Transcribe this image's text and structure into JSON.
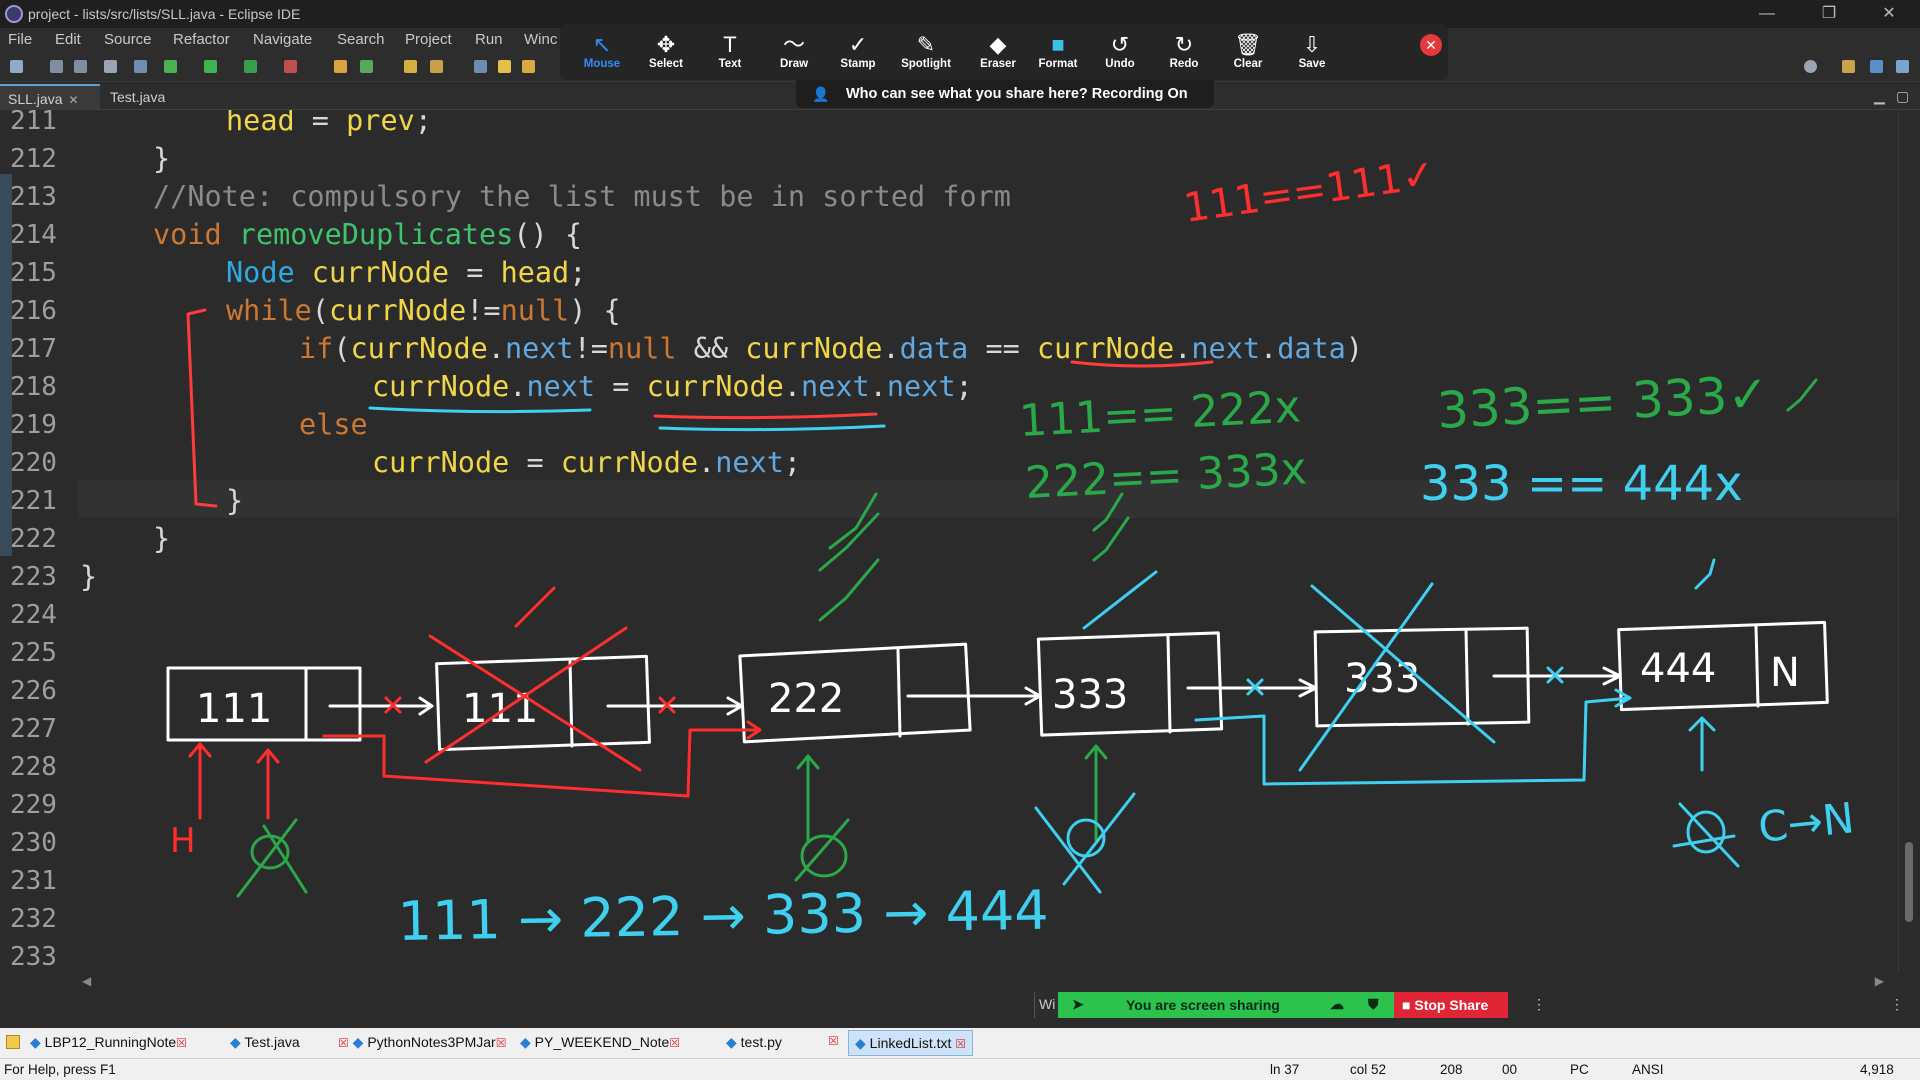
{
  "window": {
    "title": "project - lists/src/lists/SLL.java - Eclipse IDE",
    "minimize": "—",
    "restore": "❐",
    "close": "✕"
  },
  "menu": [
    "File",
    "Edit",
    "Source",
    "Refactor",
    "Navigate",
    "Search",
    "Project",
    "Run",
    "Winc"
  ],
  "editor_tabs": [
    {
      "label": "SLL.java",
      "active": true
    },
    {
      "label": "Test.java",
      "active": false
    }
  ],
  "annotation_toolbar": {
    "tools": [
      {
        "label": "Mouse",
        "glyph": "↖"
      },
      {
        "label": "Select",
        "glyph": "✥"
      },
      {
        "label": "Text",
        "glyph": "T"
      },
      {
        "label": "Draw",
        "glyph": "〜"
      },
      {
        "label": "Stamp",
        "glyph": "✓"
      },
      {
        "label": "Spotlight",
        "glyph": "✎"
      },
      {
        "label": "Eraser",
        "glyph": "◆"
      },
      {
        "label": "Format",
        "glyph": "■"
      },
      {
        "label": "Undo",
        "glyph": "↺"
      },
      {
        "label": "Redo",
        "glyph": "↻"
      },
      {
        "label": "Clear",
        "glyph": "🗑"
      },
      {
        "label": "Save",
        "glyph": "⇩"
      }
    ],
    "selected": "Mouse",
    "close_glyph": "✕",
    "recording_notice": "Who can see what you share here? Recording On",
    "colors": {
      "selected": "#2f8cff",
      "close": "#e5393b",
      "format": "#3bc0e8"
    }
  },
  "code": {
    "line_numbers": [
      "211",
      "212",
      "213",
      "214",
      "215",
      "216",
      "217",
      "218",
      "219",
      "220",
      "221",
      "222",
      "223",
      "224",
      "225",
      "226",
      "227",
      "228",
      "229",
      "230",
      "231",
      "232",
      "233"
    ],
    "lines": [
      [
        [
          "head",
          "vr"
        ],
        [
          " = ",
          ""
        ],
        [
          "prev",
          "vr"
        ],
        [
          ";",
          ""
        ]
      ],
      [
        [
          "}",
          ""
        ]
      ],
      [
        [
          "//Note: compulsory the list must be in sorted form",
          "cm"
        ]
      ],
      [
        [
          "void ",
          "kw"
        ],
        [
          "removeDuplicates",
          "fn"
        ],
        [
          "() {",
          ""
        ]
      ],
      [
        [
          "Node ",
          "ty"
        ],
        [
          "currNode",
          "vr"
        ],
        [
          " = ",
          ""
        ],
        [
          "head",
          "vr"
        ],
        [
          ";",
          ""
        ]
      ],
      [
        [
          "while",
          "kw"
        ],
        [
          "(",
          ""
        ],
        [
          "currNode",
          "vr"
        ],
        [
          "!=",
          ""
        ],
        [
          "null",
          "kw"
        ],
        [
          ") {",
          ""
        ]
      ],
      [
        [
          "if",
          "kw"
        ],
        [
          "(",
          ""
        ],
        [
          "currNode",
          "vr"
        ],
        [
          ".",
          ""
        ],
        [
          "next",
          "fd"
        ],
        [
          "!=",
          ""
        ],
        [
          "null",
          "kw"
        ],
        [
          " && ",
          ""
        ],
        [
          "currNode",
          "vr"
        ],
        [
          ".",
          ""
        ],
        [
          "data",
          "fd"
        ],
        [
          " == ",
          ""
        ],
        [
          "currNode",
          "vr"
        ],
        [
          ".",
          ""
        ],
        [
          "next",
          "fd"
        ],
        [
          ".",
          ""
        ],
        [
          "data",
          "fd"
        ],
        [
          ")",
          ""
        ]
      ],
      [
        [
          "currNode",
          "vr"
        ],
        [
          ".",
          ""
        ],
        [
          "next",
          "fd"
        ],
        [
          " = ",
          ""
        ],
        [
          "currNode",
          "vr"
        ],
        [
          ".",
          ""
        ],
        [
          "next",
          "fd"
        ],
        [
          ".",
          ""
        ],
        [
          "next",
          "fd"
        ],
        [
          ";",
          ""
        ]
      ],
      [
        [
          "else",
          "kw"
        ]
      ],
      [
        [
          "currNode",
          "vr"
        ],
        [
          " = ",
          ""
        ],
        [
          "currNode",
          "vr"
        ],
        [
          ".",
          ""
        ],
        [
          "next",
          "fd"
        ],
        [
          ";",
          ""
        ]
      ],
      [
        [
          "}",
          ""
        ]
      ],
      [
        [
          "}",
          ""
        ]
      ],
      [
        [
          "}",
          ""
        ]
      ]
    ],
    "indent": [
      2,
      1,
      1,
      1,
      2,
      2,
      3,
      4,
      3,
      4,
      2,
      1,
      0
    ]
  },
  "handwriting": {
    "compare1": "111==111✓",
    "compare2": "111== 222x",
    "compare3": "222== 333x",
    "compare4": "333== 333✓",
    "compare5": "333 == 444x",
    "node_values": [
      "111",
      "111",
      "222",
      "333",
      "333",
      "444"
    ],
    "last_next": "N",
    "labels": {
      "head": "H",
      "cleared": "C",
      "c_to_n": "C→N"
    },
    "result": "111 → 222 → 333 → 444"
  },
  "share_bar": {
    "status": "You are screen sharing",
    "stop": "Stop Share",
    "w_tab": "Wi"
  },
  "bottom_tabs": [
    {
      "label": "LBP12_RunningNote"
    },
    {
      "label": "Test.java"
    },
    {
      "label": "PythonNotes3PMJar"
    },
    {
      "label": "PY_WEEKEND_Note"
    },
    {
      "label": "test.py"
    },
    {
      "label": "LinkedList.txt"
    }
  ],
  "status_bar": {
    "help": "For Help, press F1",
    "ln": "ln 37",
    "col": "col 52",
    "chars": "208",
    "zero": "00",
    "pc": "PC",
    "enc": "ANSI",
    "count": "4,918"
  }
}
